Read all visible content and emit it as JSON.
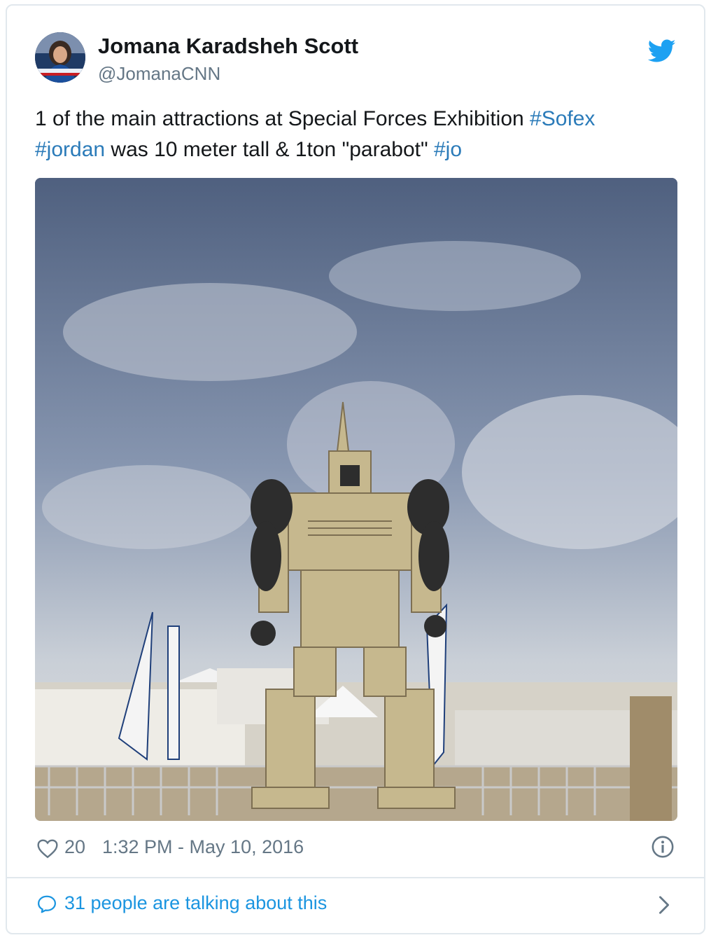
{
  "tweet": {
    "author": {
      "display_name": "Jomana Karadsheh Scott",
      "screen_name": "@JomanaCNN"
    },
    "text": {
      "part1": "1 of the main attractions at Special Forces Exhibition ",
      "hashtag1": "#Sofex",
      "hashtag2": "#jordan",
      "part2": " was 10 meter tall & 1ton \"parabot\" ",
      "hashtag3": "#jo"
    },
    "likes": "20",
    "timestamp": "1:32 PM - May 10, 2016",
    "talking": "31 people are talking about this"
  },
  "colors": {
    "link": "#2b7bb9",
    "twitter_blue": "#1da1f2",
    "muted": "#657786",
    "border": "#e1e8ed"
  },
  "icons": [
    "twitter-bird-icon",
    "heart-icon",
    "info-icon",
    "speech-bubble-icon",
    "chevron-right-icon"
  ]
}
